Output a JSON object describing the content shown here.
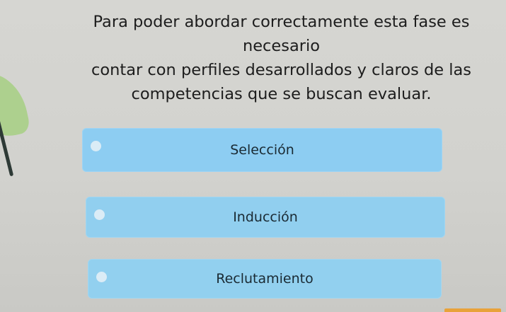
{
  "question": {
    "line1": "Para poder abordar correctamente esta fase es necesario",
    "line2": "contar con perfiles desarrollados y claros de las",
    "line3": "competencias que se buscan evaluar."
  },
  "options": [
    {
      "label": "Selección"
    },
    {
      "label": "Inducción"
    },
    {
      "label": "Reclutamiento"
    }
  ],
  "colors": {
    "option_background": "#8ecdf0",
    "text": "#1d1d1d",
    "accent": "#e8a23a"
  }
}
